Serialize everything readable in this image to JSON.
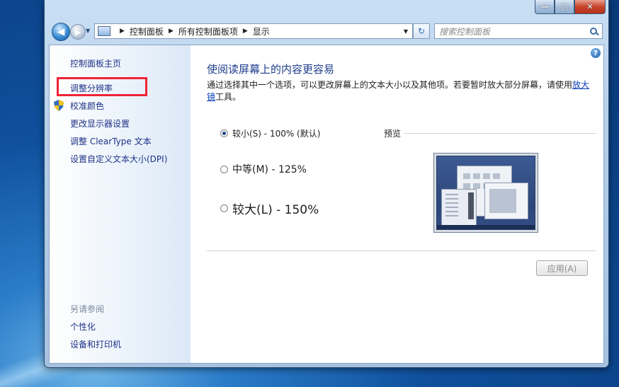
{
  "window": {
    "controls": {
      "minimize": "—",
      "maximize": "□",
      "close": "✕"
    }
  },
  "address": {
    "breadcrumbs": [
      "控制面板",
      "所有控制面板项",
      "显示"
    ]
  },
  "search": {
    "placeholder": "搜索控制面板"
  },
  "sidebar": {
    "home": "控制面板主页",
    "items": [
      "调整分辨率",
      "校准颜色",
      "更改显示器设置",
      "调整 ClearType 文本",
      "设置自定义文本大小(DPI)"
    ],
    "see_also_title": "另请参阅",
    "see_also": [
      "个性化",
      "设备和打印机"
    ]
  },
  "main": {
    "heading": "使阅读屏幕上的内容更容易",
    "intro_text": "通过选择其中一个选项，可以更改屏幕上的文本大小以及其他项。若要暂时放大部分屏幕，请使用",
    "intro_link": "放大镜",
    "intro_tail": "工具。",
    "options": [
      {
        "label": "较小(S) - 100% (默认)",
        "checked": true
      },
      {
        "label": "中等(M) - 125%",
        "checked": false
      },
      {
        "label": "较大(L) - 150%",
        "checked": false
      }
    ],
    "preview_label": "预览",
    "apply_label": "应用(A)"
  },
  "colors": {
    "link": "#1e3287",
    "highlight": "#f02336",
    "heading": "#1e3d8c"
  }
}
